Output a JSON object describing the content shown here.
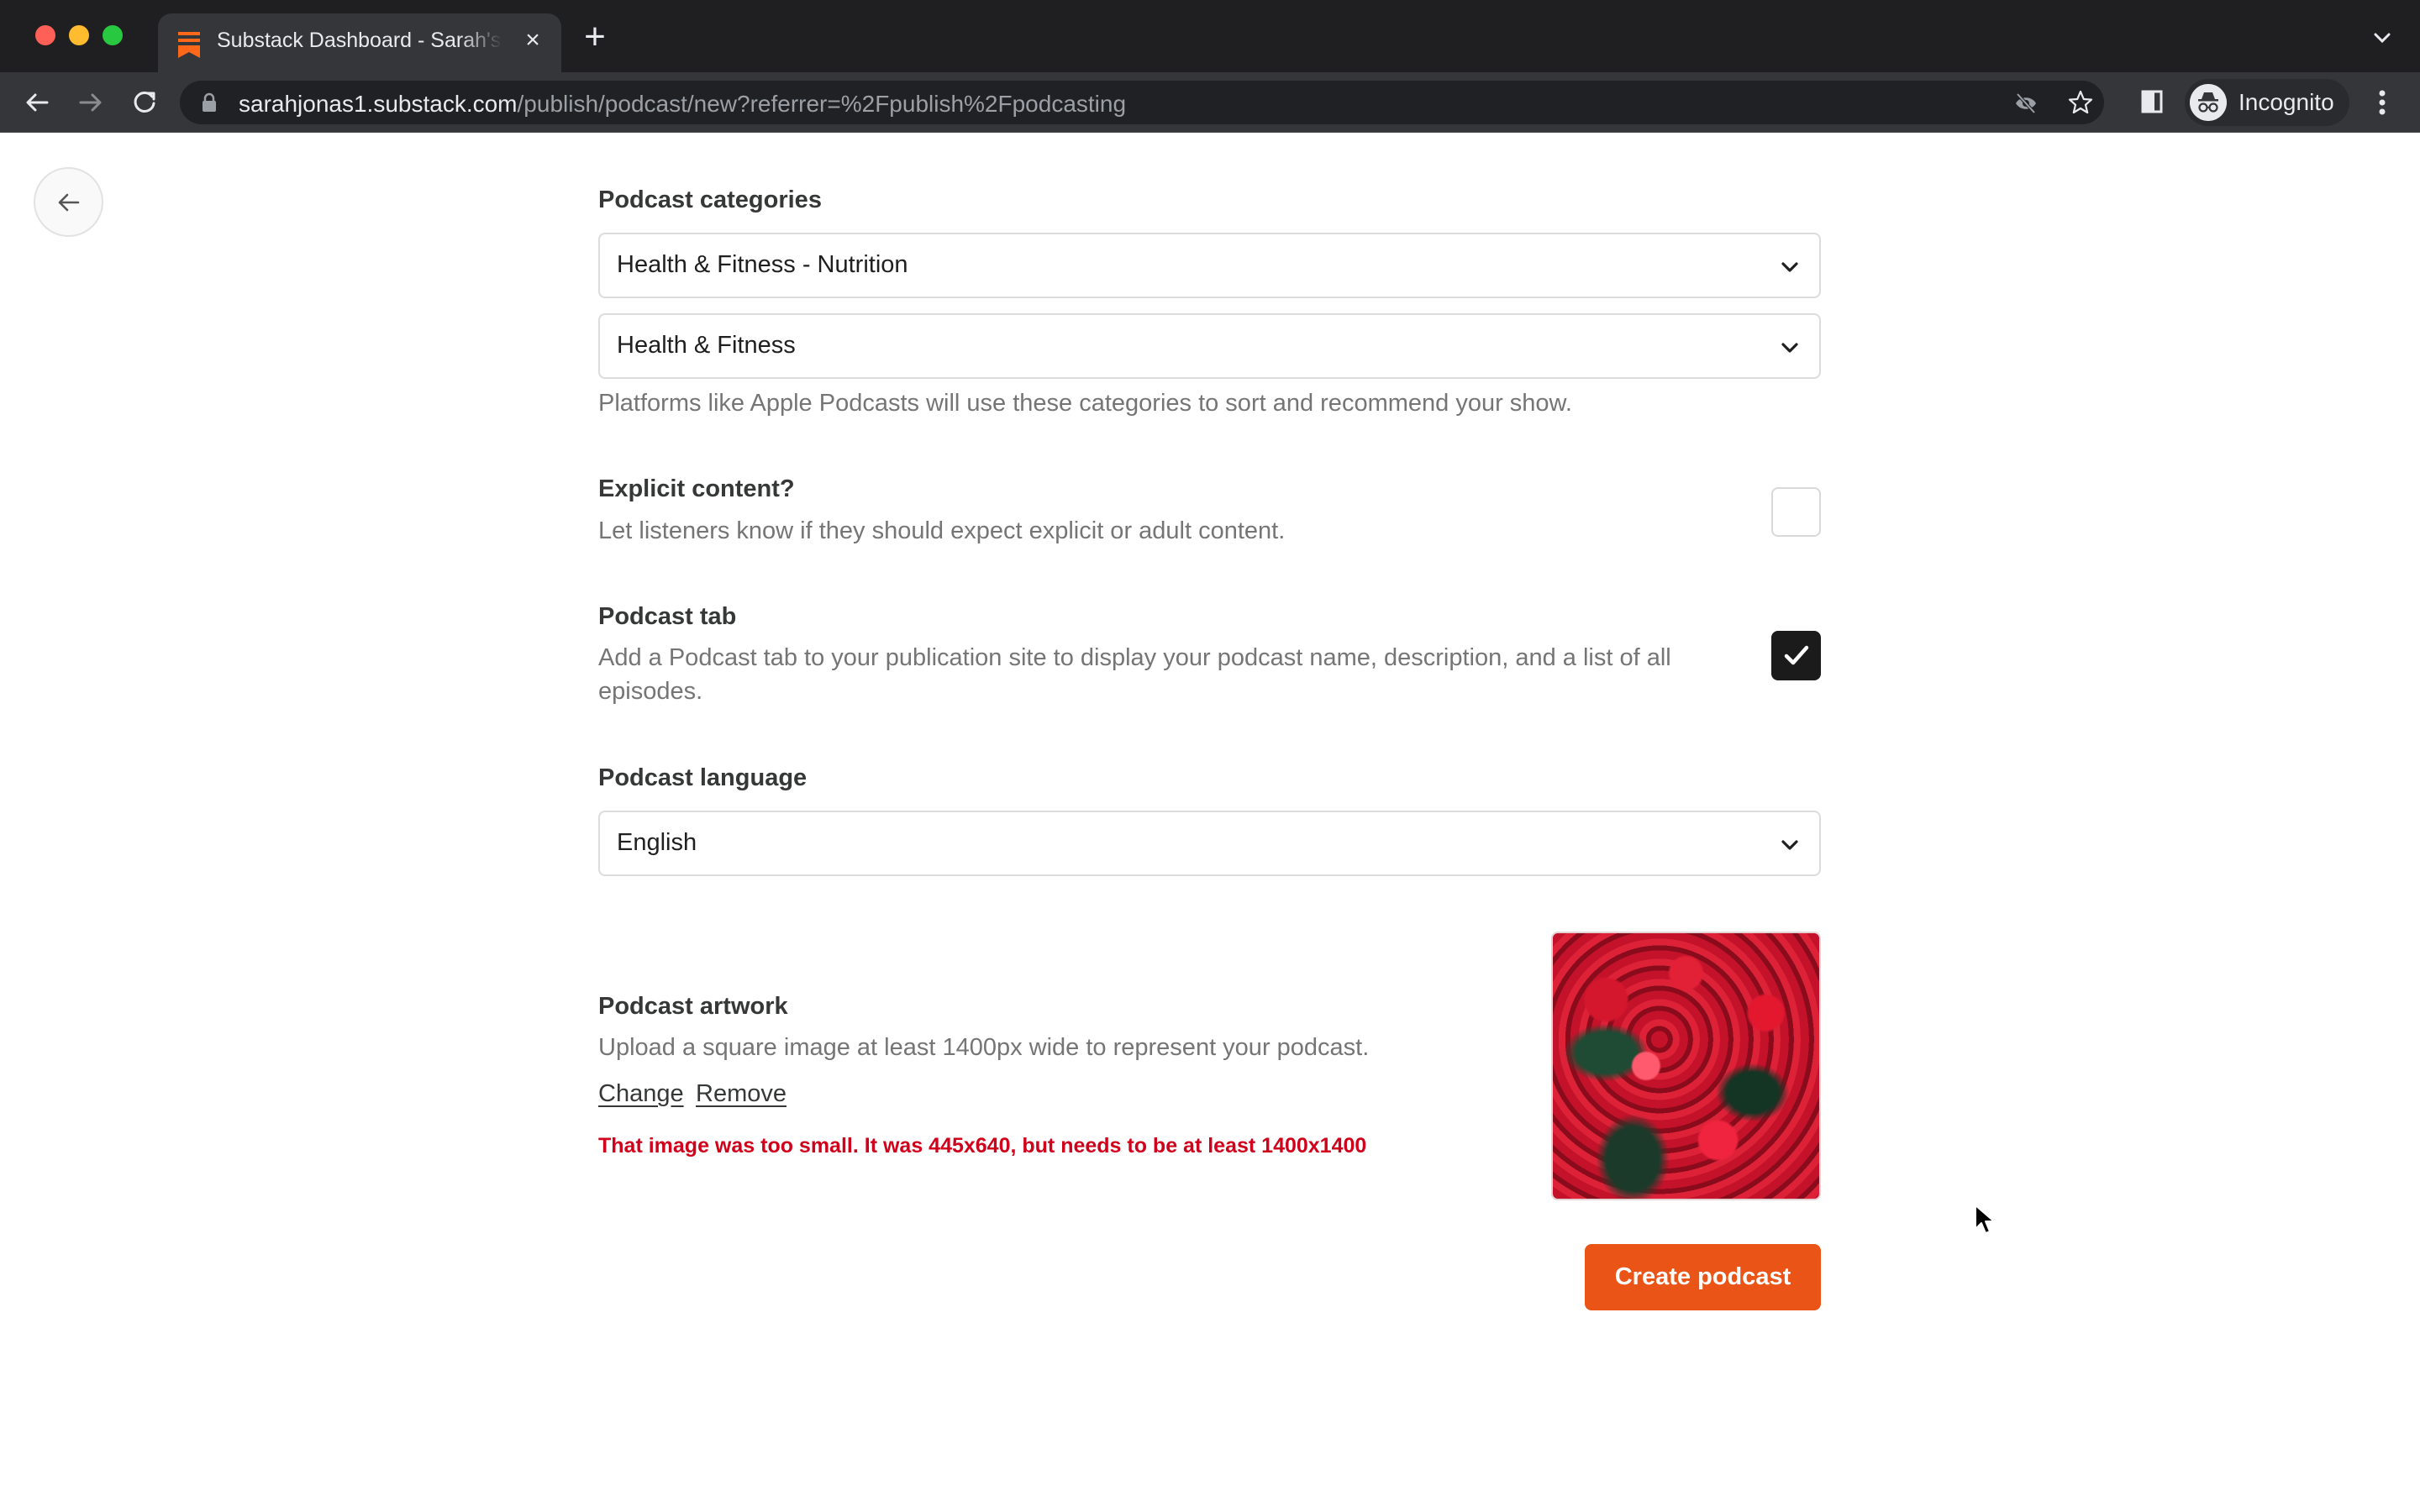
{
  "browser": {
    "tab_title": "Substack Dashboard - Sarah's",
    "url_host": "sarahjonas1.substack.com",
    "url_path": "/publish/podcast/new?referrer=%2Fpublish%2Fpodcasting",
    "profile_label": "Incognito",
    "favicon_color": "#ff6719"
  },
  "page": {
    "back_button": "back-arrow-icon",
    "categories": {
      "label": "Podcast categories",
      "primary_value": "Health & Fitness - Nutrition",
      "secondary_value": "Health & Fitness",
      "help": "Platforms like Apple Podcasts will use these categories to sort and recommend your show."
    },
    "explicit": {
      "label": "Explicit content?",
      "description": "Let listeners know if they should expect explicit or adult content.",
      "checked": false
    },
    "podcast_tab": {
      "label": "Podcast tab",
      "description": "Add a Podcast tab to your publication site to display your podcast name, description, and a list of all episodes.",
      "checked": true
    },
    "language": {
      "label": "Podcast language",
      "value": "English"
    },
    "artwork": {
      "label": "Podcast artwork",
      "description": "Upload a square image at least 1400px wide to represent your podcast.",
      "change_label": "Change",
      "remove_label": "Remove",
      "error": "That image was too small. It was 445x640, but needs to be at least 1400x1400",
      "image_alt": "red flowers"
    },
    "create_button": "Create podcast",
    "accent_color": "#ea5417",
    "error_color": "#d0021b"
  }
}
